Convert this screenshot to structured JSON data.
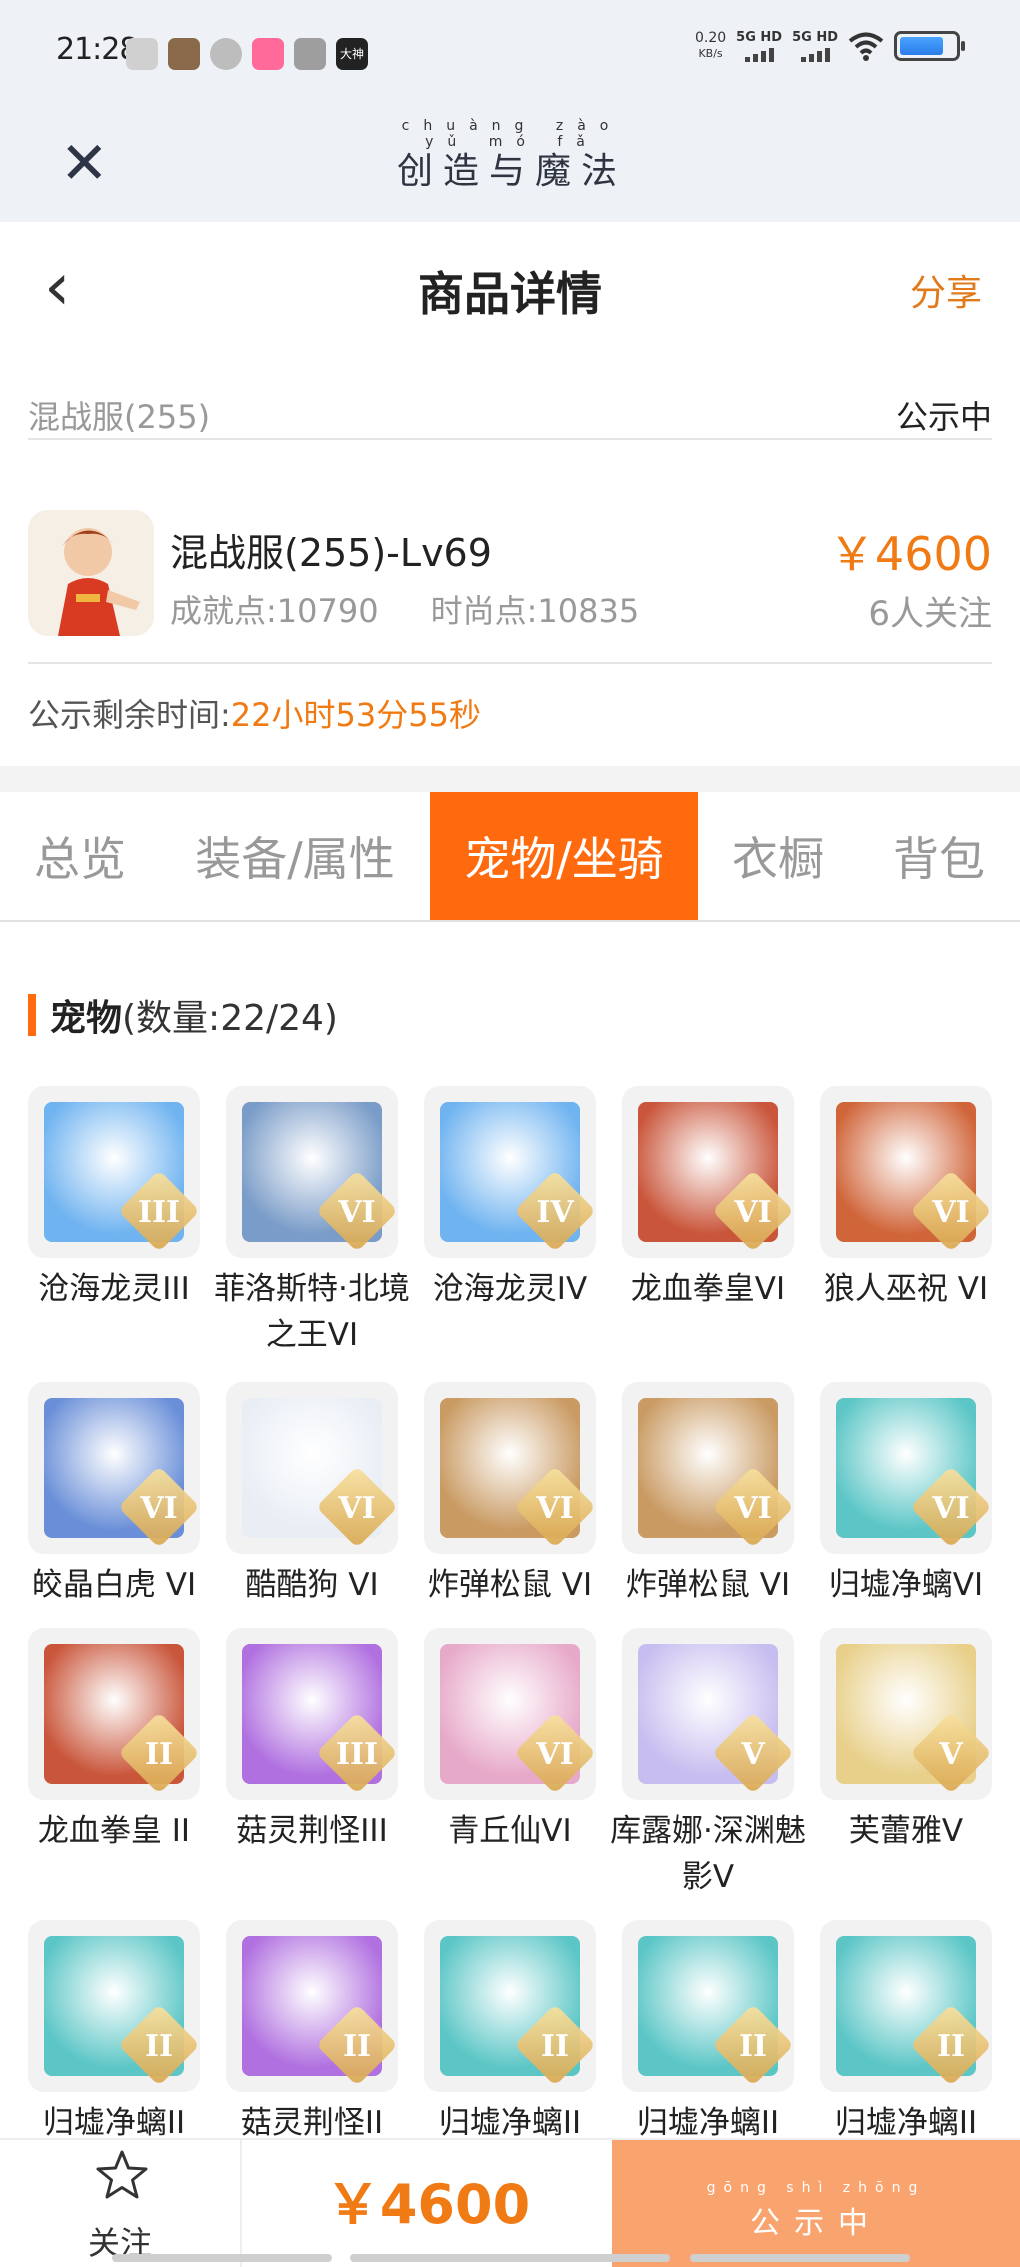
{
  "status_bar": {
    "time": "21:28",
    "net_speed": "0.20",
    "net_unit": "KB/s",
    "sim1": "5G HD",
    "sim2": "5G HD",
    "app_icons": [
      "wechat-icon",
      "game-avatar-icon",
      "chat-bubble-icon",
      "bilibili-icon",
      "gamepad-icon",
      "dashen-icon"
    ],
    "dashen_label": "大神"
  },
  "app_bar": {
    "brand_pinyin": "chuàng zào yǔ mó fǎ",
    "brand_text": "创造与魔法"
  },
  "header": {
    "title": "商品详情",
    "share_label": "分享"
  },
  "listing": {
    "server": "混战服(255)",
    "status": "公示中",
    "title": "混战服(255)-Lv69",
    "achievement": "成就点:10790",
    "fashion": "时尚点:10835",
    "price": "￥4600",
    "watchers": "6人关注",
    "remain_label": "公示剩余时间:",
    "remain_value": "22小时53分55秒"
  },
  "tabs": [
    {
      "label": "总览",
      "active": false
    },
    {
      "label": "装备/属性",
      "active": false
    },
    {
      "label": "宠物/坐骑",
      "active": true
    },
    {
      "label": "衣橱",
      "active": false
    },
    {
      "label": "背包",
      "active": false
    }
  ],
  "pets_section": {
    "title": "宠物",
    "count": "(数量:22/24)"
  },
  "pets": [
    {
      "name": "沧海龙灵III",
      "grade": "III",
      "color": "#6fb3f0"
    },
    {
      "name": "菲洛斯特·北境之王VI",
      "grade": "VI",
      "color": "#7a9cc8"
    },
    {
      "name": "沧海龙灵IV",
      "grade": "IV",
      "color": "#6fb3f0"
    },
    {
      "name": "龙血拳皇VI",
      "grade": "VI",
      "color": "#c9553a"
    },
    {
      "name": "狼人巫祝 VI",
      "grade": "VI",
      "color": "#d0653a"
    },
    {
      "name": "皎晶白虎 VI",
      "grade": "VI",
      "color": "#6a8fd8"
    },
    {
      "name": "酷酷狗 VI",
      "grade": "VI",
      "color": "#e9eef5"
    },
    {
      "name": "炸弹松鼠 VI",
      "grade": "VI",
      "color": "#c99a62"
    },
    {
      "name": "炸弹松鼠 VI",
      "grade": "VI",
      "color": "#c99a62"
    },
    {
      "name": "归墟净螭VI",
      "grade": "VI",
      "color": "#5cc6c6"
    },
    {
      "name": "龙血拳皇 II",
      "grade": "II",
      "color": "#c9553a"
    },
    {
      "name": "菇灵荆怪III",
      "grade": "III",
      "color": "#b070e0"
    },
    {
      "name": "青丘仙VI",
      "grade": "VI",
      "color": "#e7a9c9"
    },
    {
      "name": "库露娜·深渊魅影V",
      "grade": "V",
      "color": "#c8bdf0"
    },
    {
      "name": "芙蕾雅V",
      "grade": "V",
      "color": "#e8d08a"
    },
    {
      "name": "归墟净螭II",
      "grade": "II",
      "color": "#5cc6c6"
    },
    {
      "name": "菇灵荆怪II",
      "grade": "II",
      "color": "#b070e0"
    },
    {
      "name": "归墟净螭II",
      "grade": "II",
      "color": "#5cc6c6"
    },
    {
      "name": "归墟净螭II",
      "grade": "II",
      "color": "#5cc6c6"
    },
    {
      "name": "归墟净螭II",
      "grade": "II",
      "color": "#5cc6c6"
    }
  ],
  "bottom_bar": {
    "follow_label": "关注",
    "price": "￥4600",
    "public_pinyin": "gōng shì zhōng",
    "public_label": "公示中"
  },
  "colors": {
    "accent": "#ff6a0e",
    "price": "#f07a14",
    "public_button": "#f9a36e"
  }
}
